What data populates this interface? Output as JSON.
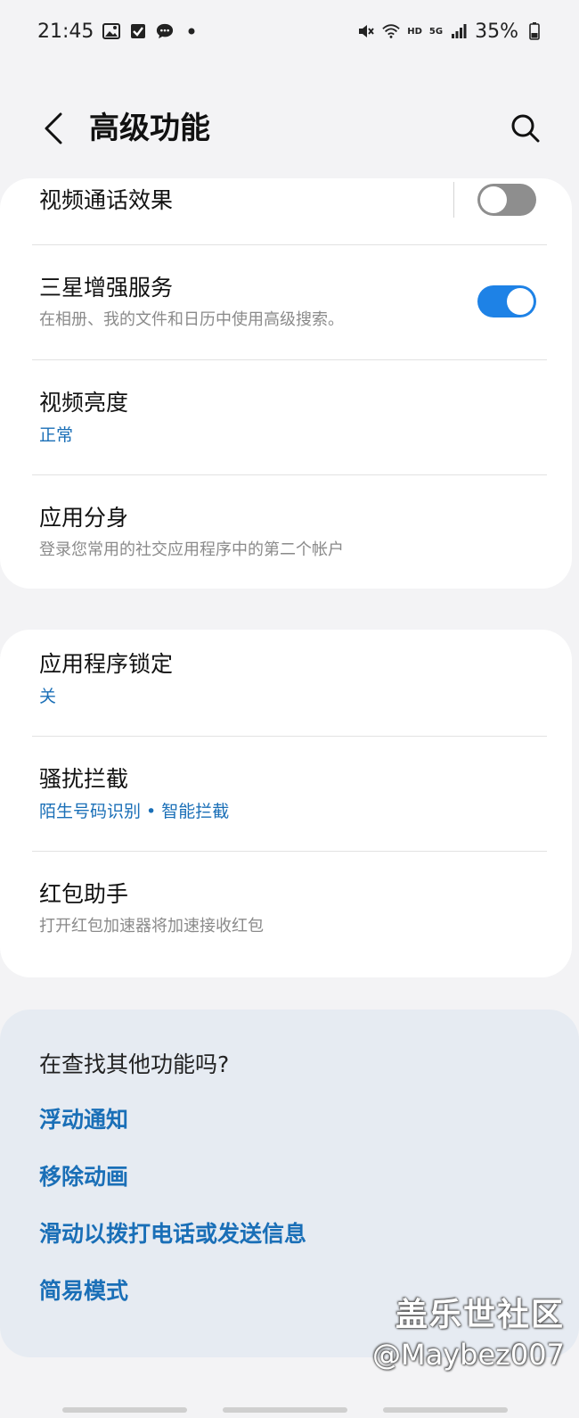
{
  "status_bar": {
    "time": "21:45",
    "battery": "35%",
    "hd": "HD",
    "network": "5G"
  },
  "app_bar": {
    "title": "高级功能"
  },
  "group1": {
    "items": [
      {
        "title": "视频通话效果",
        "subtitle": "",
        "toggle": "off"
      },
      {
        "title": "三星增强服务",
        "subtitle": "在相册、我的文件和日历中使用高级搜索。",
        "toggle": "on"
      },
      {
        "title": "视频亮度",
        "subtitle": "正常"
      },
      {
        "title": "应用分身",
        "subtitle": "登录您常用的社交应用程序中的第二个帐户"
      }
    ]
  },
  "group2": {
    "items": [
      {
        "title": "应用程序锁定",
        "subtitle": "关"
      },
      {
        "title": "骚扰拦截",
        "subtitle": "陌生号码识别 • 智能拦截"
      },
      {
        "title": "红包助手",
        "subtitle": "打开红包加速器将加速接收红包"
      }
    ]
  },
  "suggestions": {
    "title": "在查找其他功能吗?",
    "links": [
      "浮动通知",
      "移除动画",
      "滑动以拨打电话或发送信息",
      "简易模式"
    ]
  },
  "watermark": {
    "line1": "盖乐世社区",
    "line2": "@Maybez007"
  },
  "colors": {
    "accent": "#1a6fb7",
    "toggle_on": "#1e82e6",
    "toggle_off": "#8e8e8e",
    "background": "#f3f3f5",
    "suggest_bg": "#e6ebf2"
  }
}
